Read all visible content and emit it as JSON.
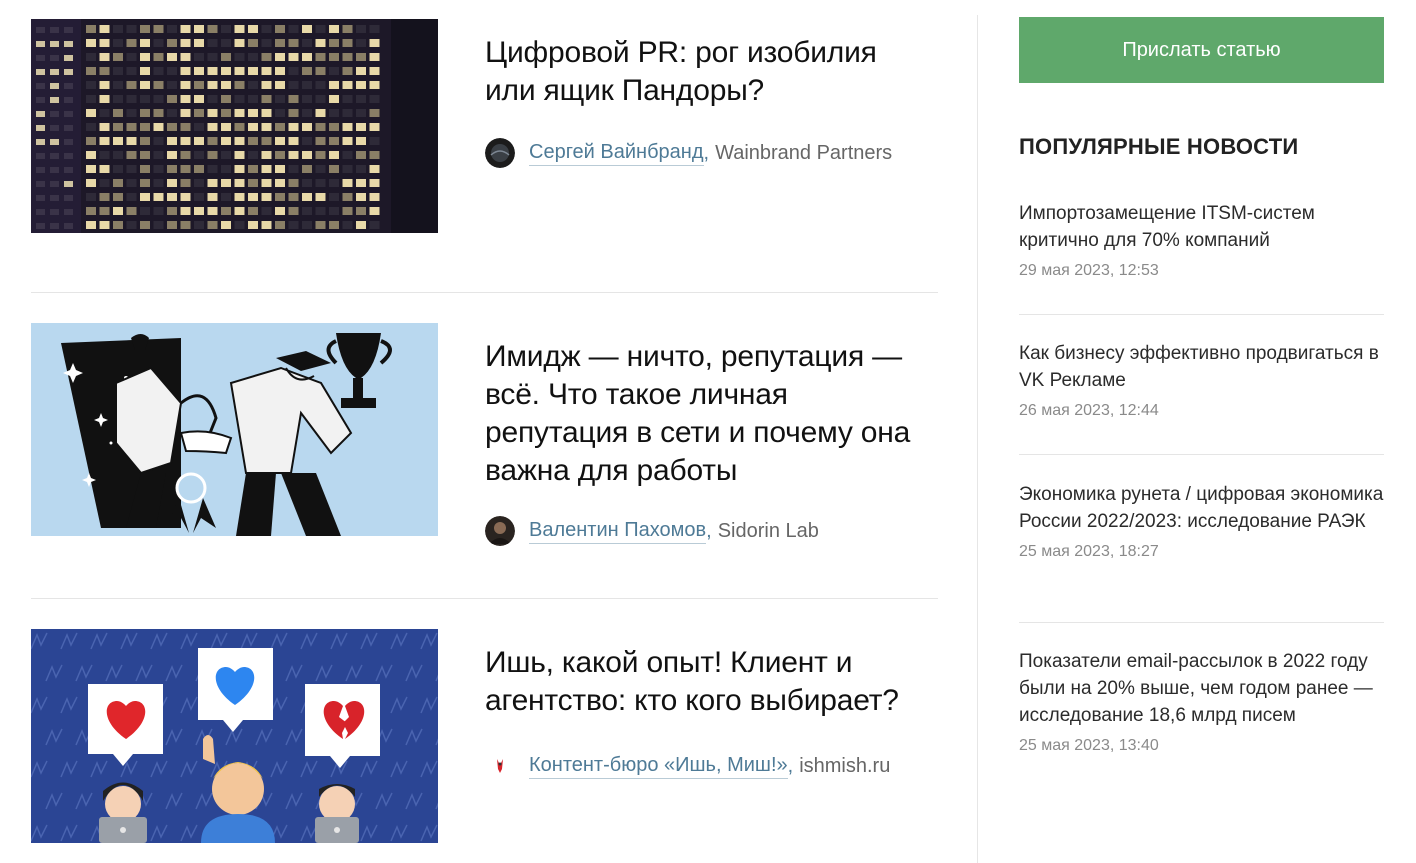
{
  "articles": [
    {
      "title": "Цифровой PR: рог изобилия или ящик Пандоры?",
      "author": "Сергей Вайнбранд",
      "separator": ",",
      "company": "Wainbrand Partners"
    },
    {
      "title": "Имидж — ничто, репутация — всё. Что такое личная репутация в сети и почему она важна для работы",
      "author": "Валентин Пахомов",
      "separator": ",",
      "company": "Sidorin Lab"
    },
    {
      "title": "Ишь, какой опыт! Клиент и агентство: кто кого выбирает?",
      "author": "Контент-бюро «Ишь, Миш!»",
      "separator": ",",
      "company": "ishmish.ru"
    }
  ],
  "sidebar": {
    "submit_label": "Прислать статью",
    "popular_title": "ПОПУЛЯРНЫЕ НОВОСТИ",
    "news": [
      {
        "title": "Импортозамещение ITSM-систем критично для 70% компаний",
        "date": "29 мая 2023, 12:53"
      },
      {
        "title": "Как бизнесу эффективно продвигаться в VK Рекламе",
        "date": "26 мая 2023, 12:44"
      },
      {
        "title": "Экономика рунета / цифровая экономика России 2022/2023: исследование РАЭК",
        "date": "25 мая 2023, 18:27"
      },
      {
        "title": "Показатели email-рассылок в 2022 году были на 20% выше, чем годом ранее — исследование 18,6 млрд писем",
        "date": "25 мая 2023, 13:40"
      }
    ]
  },
  "colors": {
    "accent_button": "#5fa86b",
    "author_link": "#4e7a96",
    "illustration_bg_blue": "#b9d8ef",
    "illustration_bg_navy": "#2b4594"
  },
  "icons": {
    "heart_red": "red-heart-icon",
    "heart_blue": "blue-heart-icon",
    "heart_broken": "broken-heart-icon"
  }
}
